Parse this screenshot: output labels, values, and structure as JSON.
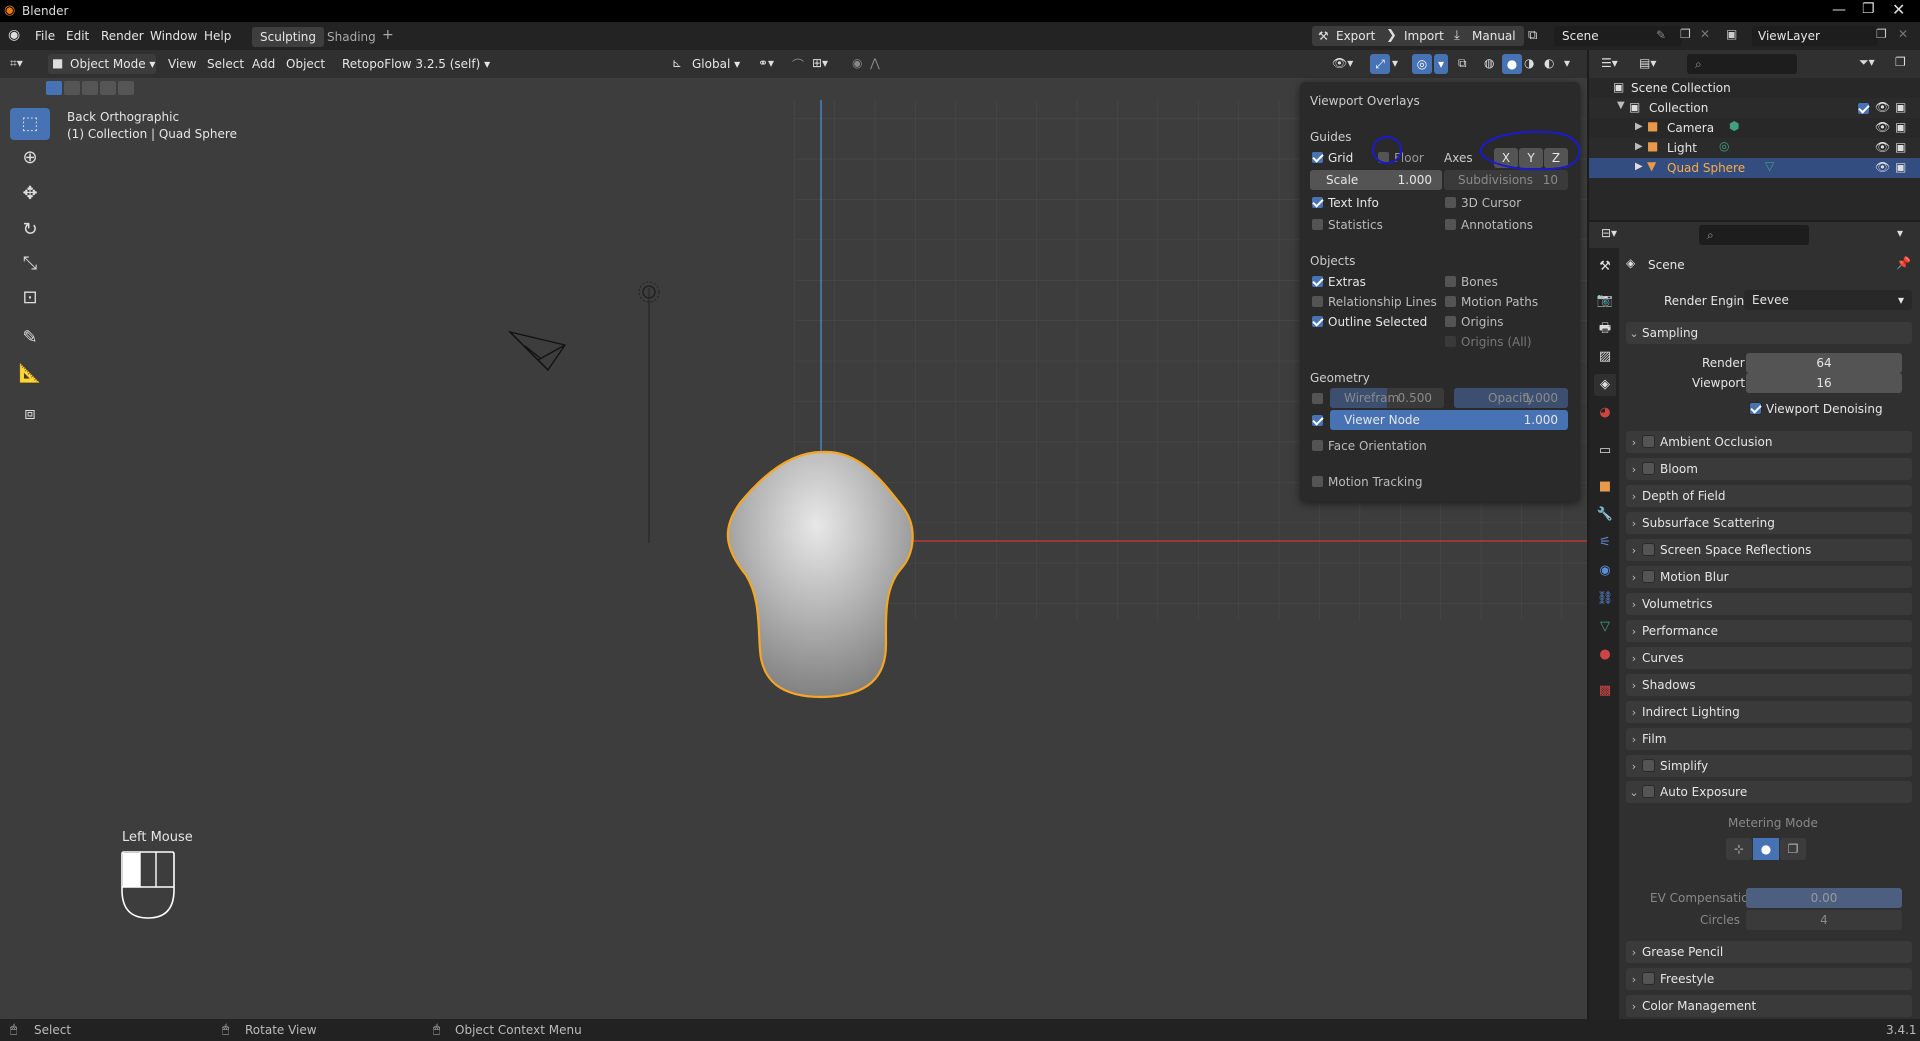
{
  "app": {
    "title": "Blender",
    "version": "3.4.1"
  },
  "topbar": {
    "menus": [
      "File",
      "Edit",
      "Render",
      "Window",
      "Help"
    ],
    "workspaces": [
      "Sculpting",
      "Shading"
    ],
    "add_tab": "+",
    "right": {
      "export": "Export",
      "import": "Import",
      "manual": "Manual",
      "scene": "Scene",
      "view_layer": "ViewLayer"
    }
  },
  "viewport_header": {
    "mode": "Object Mode",
    "menus": [
      "View",
      "Select",
      "Add",
      "Object"
    ],
    "addon": "RetopoFlow 3.2.5 (self)",
    "orientation": "Global"
  },
  "viewport": {
    "view_name": "Back Orthographic",
    "collection_info": "(1) Collection | Quad Sphere",
    "mouse_label": "Left Mouse"
  },
  "overlays": {
    "title": "Viewport Overlays",
    "guides_label": "Guides",
    "grid": {
      "label": "Grid",
      "checked": true
    },
    "floor": {
      "label": "Floor",
      "checked": false
    },
    "axes_label": "Axes",
    "axes": [
      "X",
      "Y",
      "Z"
    ],
    "scale": {
      "label": "Scale",
      "value": "1.000"
    },
    "subdivisions": {
      "label": "Subdivisions",
      "value": "10"
    },
    "text_info": {
      "label": "Text Info",
      "checked": true
    },
    "cursor_3d": {
      "label": "3D Cursor",
      "checked": false
    },
    "statistics": {
      "label": "Statistics",
      "checked": false
    },
    "annotations": {
      "label": "Annotations",
      "checked": false
    },
    "objects_label": "Objects",
    "extras": {
      "label": "Extras",
      "checked": true
    },
    "bones": {
      "label": "Bones",
      "checked": false
    },
    "relationship_lines": {
      "label": "Relationship Lines",
      "checked": false
    },
    "motion_paths": {
      "label": "Motion Paths",
      "checked": false
    },
    "outline_selected": {
      "label": "Outline Selected",
      "checked": true
    },
    "origins": {
      "label": "Origins",
      "checked": false
    },
    "origins_all": {
      "label": "Origins (All)",
      "checked": false
    },
    "geometry_label": "Geometry",
    "wireframe": {
      "label": "Wirefram",
      "value": "0.500",
      "checked": false
    },
    "opacity": {
      "label": "Opacity",
      "value": "1.000"
    },
    "viewer_node": {
      "label": "Viewer Node",
      "value": "1.000",
      "checked": true
    },
    "face_orientation": {
      "label": "Face Orientation",
      "checked": false
    },
    "motion_tracking": {
      "label": "Motion Tracking",
      "checked": false
    }
  },
  "outliner": {
    "root": "Scene Collection",
    "collection": "Collection",
    "items": [
      "Camera",
      "Light",
      "Quad Sphere"
    ]
  },
  "properties": {
    "context": "Scene",
    "render_engine_label": "Render Engine",
    "render_engine": "Eevee",
    "sampling": {
      "label": "Sampling",
      "render_label": "Render",
      "render_value": "64",
      "viewport_label": "Viewport",
      "viewport_value": "16",
      "denoise_label": "Viewport Denoising"
    },
    "panels": [
      {
        "label": "Ambient Occlusion",
        "checkbox": true
      },
      {
        "label": "Bloom",
        "checkbox": true
      },
      {
        "label": "Depth of Field",
        "checkbox": false
      },
      {
        "label": "Subsurface Scattering",
        "checkbox": false
      },
      {
        "label": "Screen Space Reflections",
        "checkbox": true
      },
      {
        "label": "Motion Blur",
        "checkbox": true
      },
      {
        "label": "Volumetrics",
        "checkbox": false
      },
      {
        "label": "Performance",
        "checkbox": false
      },
      {
        "label": "Curves",
        "checkbox": false
      },
      {
        "label": "Shadows",
        "checkbox": false
      },
      {
        "label": "Indirect Lighting",
        "checkbox": false
      },
      {
        "label": "Film",
        "checkbox": false
      },
      {
        "label": "Simplify",
        "checkbox": true
      }
    ],
    "auto_exposure": {
      "label": "Auto Exposure",
      "metering_label": "Metering Mode",
      "ev_label": "EV Compensation",
      "ev_value": "0.00",
      "circles_label": "Circles",
      "circles_value": "4"
    },
    "bottom_panels": [
      {
        "label": "Grease Pencil",
        "checkbox": false
      },
      {
        "label": "Freestyle",
        "checkbox": true
      },
      {
        "label": "Color Management",
        "checkbox": false
      }
    ]
  },
  "statusbar": {
    "select": "Select",
    "rotate": "Rotate View",
    "context_menu": "Object Context Menu"
  },
  "colors": {
    "accent": "#4772b3",
    "selection_outline": "#f5a623",
    "annotation_ink": "#1a1ad1",
    "x_axis": "#b83a3a",
    "y_axis": "#4a7fcf"
  }
}
